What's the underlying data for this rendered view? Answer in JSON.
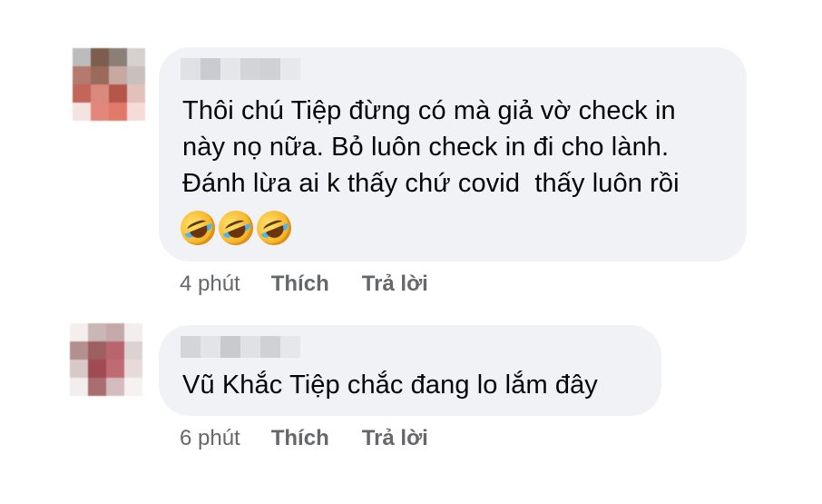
{
  "comments": [
    {
      "author": "",
      "text": "Thôi chú Tiệp đừng có mà giả vờ check in\nnày nọ nữa. Bỏ luôn check in đi cho lành.\nĐánh lừa ai k thấy chứ covid  thấy luôn rồi",
      "emojis": [
        "rolling-on-floor-laughing-icon",
        "rolling-on-floor-laughing-icon",
        "rolling-on-floor-laughing-icon"
      ],
      "time": "4 phút",
      "like_label": "Thích",
      "reply_label": "Trả lời",
      "avatar_colors": [
        "#bcbcbc",
        "#7d5e4e",
        "#8c7f78",
        "#d6d0cf",
        "#b47a70",
        "#9a6a5a",
        "#c8a9a2",
        "#c7c0bd",
        "#c36658",
        "#d9897e",
        "#b5564a",
        "#e3c1bb",
        "#f3e3e1",
        "#e2877a",
        "#e0796a",
        "#f5dcd8"
      ],
      "author_colors": [
        "#dfe1e5",
        "#c9cbd0",
        "#e4e6ea",
        "#d2d4d8",
        "#cfd1d5",
        "#e7e8eb"
      ]
    },
    {
      "author": "",
      "text": "Vũ Khắc Tiệp chắc đang lo lắm đây",
      "emojis": [],
      "time": "6 phút",
      "like_label": "Thích",
      "reply_label": "Trả lời",
      "avatar_colors": [
        "#f5eeee",
        "#c9b6b6",
        "#c3a9aa",
        "#f3eded",
        "#b39090",
        "#9e5f63",
        "#b8656d",
        "#dcd2d2",
        "#d8c8c8",
        "#a24a52",
        "#c06b73",
        "#e8dada",
        "#f4eded",
        "#a86e70",
        "#d4bcbe",
        "#f7f2f2"
      ],
      "author_colors": [
        "#d3d5d9",
        "#e2e4e7",
        "#c8cacd",
        "#dfe1e4",
        "#cfd1d4",
        "#e6e7ea"
      ]
    }
  ]
}
